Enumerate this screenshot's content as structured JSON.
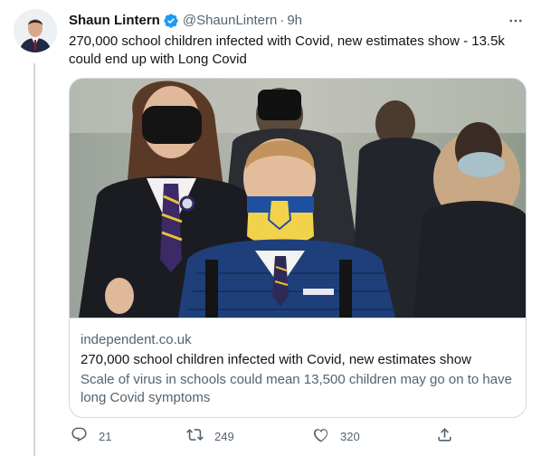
{
  "tweet": {
    "author_name": "Shaun Lintern",
    "handle": "@ShaunLintern",
    "separator": "·",
    "time": "9h",
    "text": "270,000 school children infected with Covid, new estimates show - 13.5k could end up with Long Covid"
  },
  "card": {
    "domain": "independent.co.uk",
    "title": "270,000 school children infected with Covid, new estimates show",
    "description": "Scale of virus in schools could mean 13,500 children may go on to have long Covid symptoms"
  },
  "actions": {
    "reply_count": "21",
    "retweet_count": "249",
    "like_count": "320"
  },
  "colors": {
    "verified_badge": "#1d9bf0",
    "secondary_text": "#536471",
    "border": "#cfd9de"
  },
  "icons": [
    "verified-badge-icon",
    "more-options-icon",
    "reply-icon",
    "retweet-icon",
    "like-icon",
    "share-icon"
  ]
}
